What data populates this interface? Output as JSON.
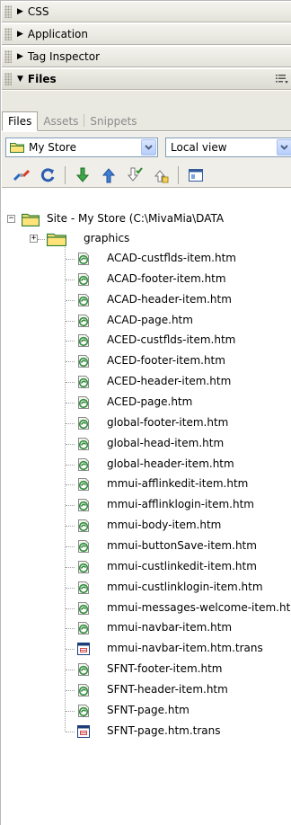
{
  "panels": {
    "css": "CSS",
    "application": "Application",
    "tag_inspector": "Tag Inspector",
    "files": "Files"
  },
  "tabs": [
    "Files",
    "Assets",
    "Snippets"
  ],
  "site_select": {
    "value": "My Store"
  },
  "view_select": {
    "value": "Local view"
  },
  "toolbar": [
    "connect-icon",
    "refresh-icon",
    "get-files-icon",
    "put-files-icon",
    "check-out-icon",
    "check-in-icon",
    "expand-icon"
  ],
  "tree": {
    "root_label": "Site - My Store (C:\\MivaMia\\DATA",
    "folder_label": "graphics",
    "files": [
      {
        "name": "ACAD-custflds-item.htm",
        "icon": "dw-file-icon"
      },
      {
        "name": "ACAD-footer-item.htm",
        "icon": "dw-file-icon"
      },
      {
        "name": "ACAD-header-item.htm",
        "icon": "dw-file-icon"
      },
      {
        "name": "ACAD-page.htm",
        "icon": "dw-file-icon"
      },
      {
        "name": "ACED-custflds-item.htm",
        "icon": "dw-file-icon"
      },
      {
        "name": "ACED-footer-item.htm",
        "icon": "dw-file-icon"
      },
      {
        "name": "ACED-header-item.htm",
        "icon": "dw-file-icon"
      },
      {
        "name": "ACED-page.htm",
        "icon": "dw-file-icon"
      },
      {
        "name": "global-footer-item.htm",
        "icon": "dw-file-icon"
      },
      {
        "name": "global-head-item.htm",
        "icon": "dw-file-icon"
      },
      {
        "name": "global-header-item.htm",
        "icon": "dw-file-icon"
      },
      {
        "name": "mmui-afflinkedit-item.htm",
        "icon": "dw-file-icon"
      },
      {
        "name": "mmui-afflinklogin-item.htm",
        "icon": "dw-file-icon"
      },
      {
        "name": "mmui-body-item.htm",
        "icon": "dw-file-icon"
      },
      {
        "name": "mmui-buttonSave-item.htm",
        "icon": "dw-file-icon"
      },
      {
        "name": "mmui-custlinkedit-item.htm",
        "icon": "dw-file-icon"
      },
      {
        "name": "mmui-custlinklogin-item.htm",
        "icon": "dw-file-icon"
      },
      {
        "name": "mmui-messages-welcome-item.htm",
        "icon": "dw-file-icon"
      },
      {
        "name": "mmui-navbar-item.htm",
        "icon": "dw-file-icon"
      },
      {
        "name": "mmui-navbar-item.htm.trans",
        "icon": "trans-file-icon"
      },
      {
        "name": "SFNT-footer-item.htm",
        "icon": "dw-file-icon"
      },
      {
        "name": "SFNT-header-item.htm",
        "icon": "dw-file-icon"
      },
      {
        "name": "SFNT-page.htm",
        "icon": "dw-file-icon"
      },
      {
        "name": "SFNT-page.htm.trans",
        "icon": "trans-file-icon"
      }
    ]
  }
}
